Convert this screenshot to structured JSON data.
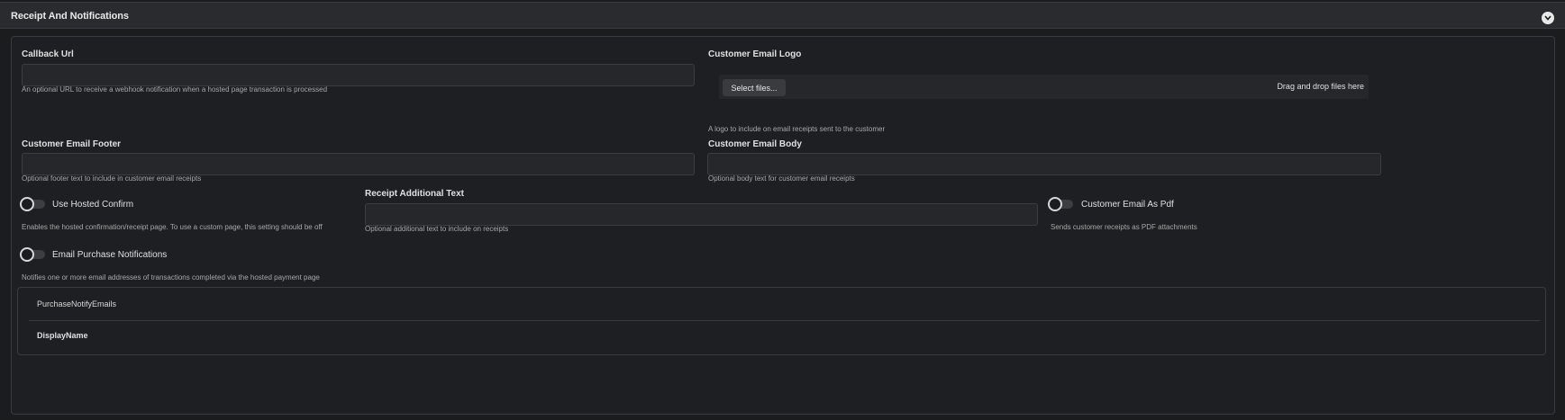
{
  "section": {
    "title": "Receipt And Notifications",
    "collapse_icon": "chevron-down-icon"
  },
  "callback_url": {
    "label": "Callback Url",
    "value": "",
    "help": "An optional URL to receive a webhook notification when a hosted page transaction is processed"
  },
  "customer_email_logo": {
    "label": "Customer Email Logo",
    "select_button": "Select files...",
    "drop_text": "Drag and drop files here",
    "help": "A logo to include on email receipts sent to the customer"
  },
  "customer_email_footer": {
    "label": "Customer Email Footer",
    "value": "",
    "help": "Optional footer text to include in customer email receipts"
  },
  "customer_email_body": {
    "label": "Customer Email Body",
    "value": "",
    "help": "Optional body text for customer email receipts"
  },
  "use_hosted_confirm": {
    "label": "Use Hosted Confirm",
    "enabled": false,
    "help": "Enables the hosted confirmation/receipt page. To use a custom page, this setting should be off"
  },
  "receipt_additional_text": {
    "label": "Receipt Additional Text",
    "value": "",
    "help": "Optional additional text to include on receipts"
  },
  "customer_email_as_pdf": {
    "label": "Customer Email As Pdf",
    "enabled": false,
    "help": "Sends customer receipts as PDF attachments"
  },
  "email_purchase_notifications": {
    "label": "Email Purchase Notifications",
    "enabled": false,
    "help": "Notifies one or more email addresses of transactions completed via the hosted payment page"
  },
  "notify_table": {
    "columns": [
      "PurchaseNotifyEmails",
      "DisplayName"
    ]
  }
}
